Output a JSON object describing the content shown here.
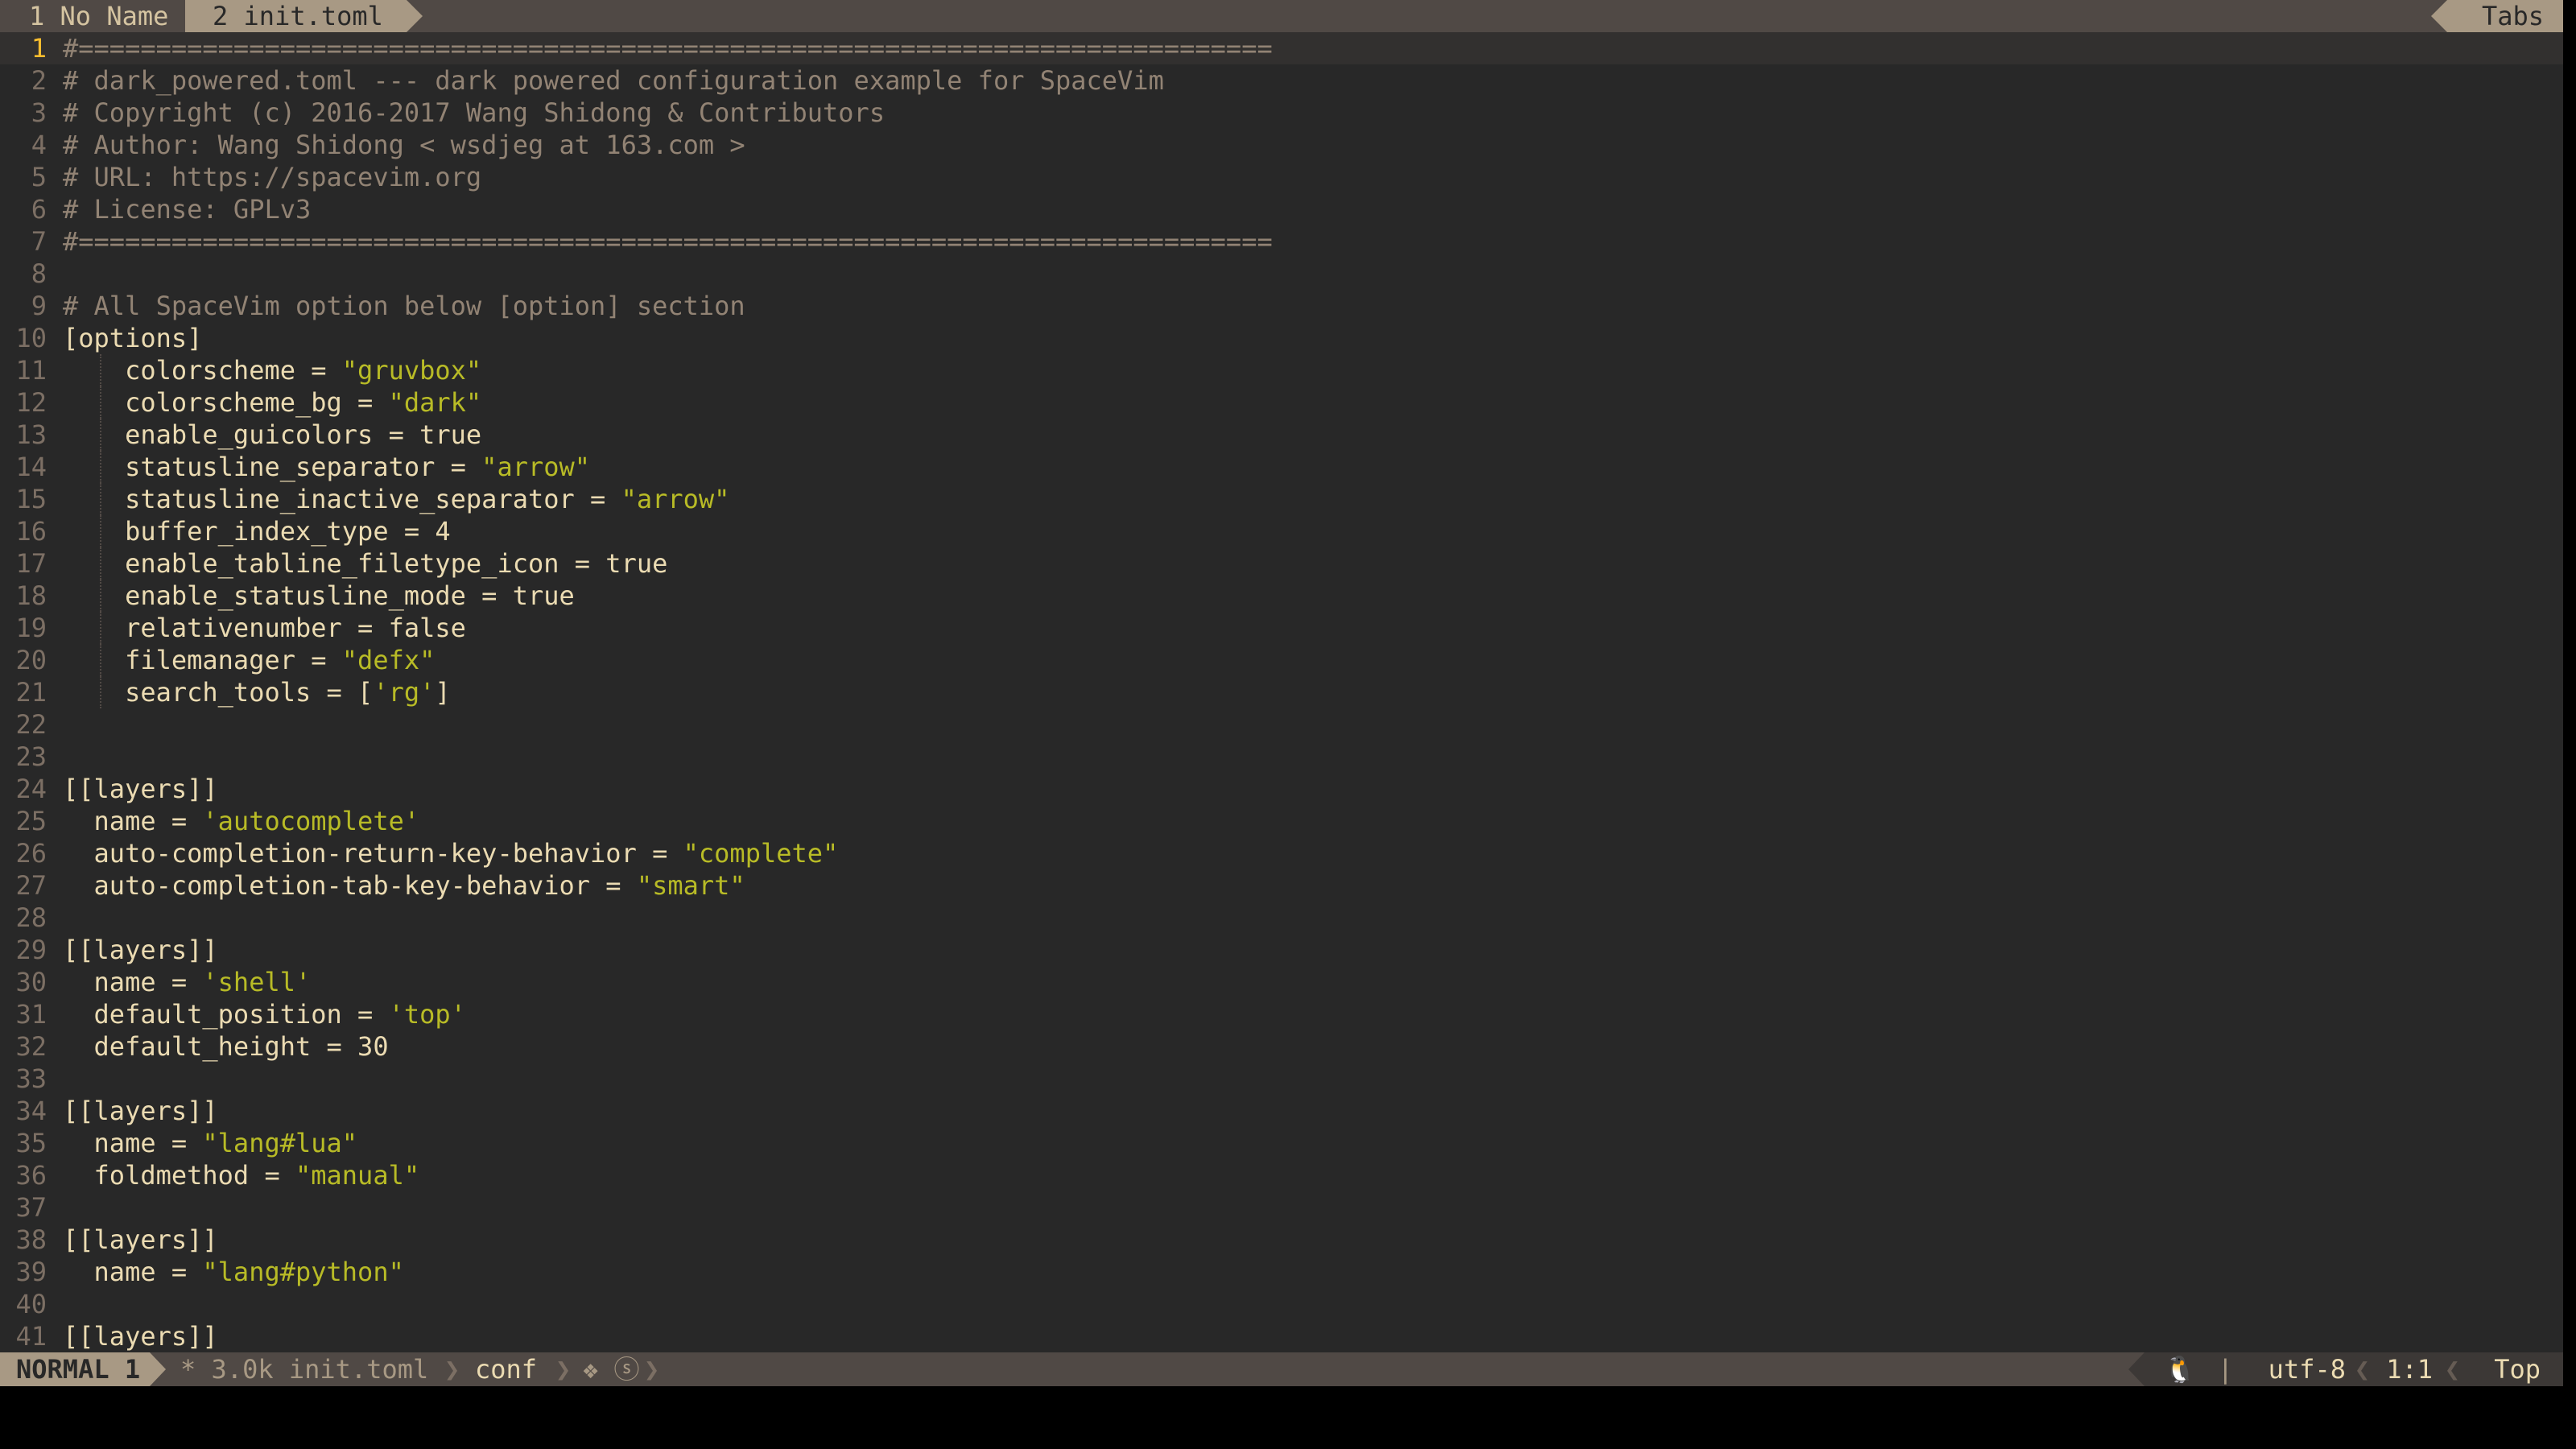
{
  "tabline": {
    "tabs": [
      {
        "index": "1",
        "label": "No Name"
      },
      {
        "index": "2",
        "label": "init.toml"
      }
    ],
    "right_label": "Tabs"
  },
  "editor": {
    "current_line": 1,
    "lines": [
      {
        "n": "1",
        "segments": [
          [
            "cm",
            "#============================================================================="
          ]
        ]
      },
      {
        "n": "2",
        "segments": [
          [
            "cm",
            "# dark_powered.toml --- dark powered configuration example for SpaceVim"
          ]
        ]
      },
      {
        "n": "3",
        "segments": [
          [
            "cm",
            "# Copyright (c) 2016-2017 Wang Shidong & Contributors"
          ]
        ]
      },
      {
        "n": "4",
        "segments": [
          [
            "cm",
            "# Author: Wang Shidong < wsdjeg at 163.com >"
          ]
        ]
      },
      {
        "n": "5",
        "segments": [
          [
            "cm",
            "# URL: https://spacevim.org"
          ]
        ]
      },
      {
        "n": "6",
        "segments": [
          [
            "cm",
            "# License: GPLv3"
          ]
        ]
      },
      {
        "n": "7",
        "segments": [
          [
            "cm",
            "#============================================================================="
          ]
        ]
      },
      {
        "n": "8",
        "segments": []
      },
      {
        "n": "9",
        "segments": [
          [
            "cm",
            "# All SpaceVim option below [option] section"
          ]
        ]
      },
      {
        "n": "10",
        "segments": [
          [
            "kw",
            "[options]"
          ]
        ]
      },
      {
        "n": "11",
        "guide": true,
        "segments": [
          [
            "kw",
            "    colorscheme = "
          ],
          [
            "str",
            "\"gruvbox\""
          ]
        ]
      },
      {
        "n": "12",
        "guide": true,
        "segments": [
          [
            "kw",
            "    colorscheme_bg = "
          ],
          [
            "str",
            "\"dark\""
          ]
        ]
      },
      {
        "n": "13",
        "guide": true,
        "segments": [
          [
            "kw",
            "    enable_guicolors = true"
          ]
        ]
      },
      {
        "n": "14",
        "guide": true,
        "segments": [
          [
            "kw",
            "    statusline_separator = "
          ],
          [
            "str",
            "\"arrow\""
          ]
        ]
      },
      {
        "n": "15",
        "guide": true,
        "segments": [
          [
            "kw",
            "    statusline_inactive_separator = "
          ],
          [
            "str",
            "\"arrow\""
          ]
        ]
      },
      {
        "n": "16",
        "guide": true,
        "segments": [
          [
            "kw",
            "    buffer_index_type = 4"
          ]
        ]
      },
      {
        "n": "17",
        "guide": true,
        "segments": [
          [
            "kw",
            "    enable_tabline_filetype_icon = true"
          ]
        ]
      },
      {
        "n": "18",
        "guide": true,
        "segments": [
          [
            "kw",
            "    enable_statusline_mode = true"
          ]
        ]
      },
      {
        "n": "19",
        "guide": true,
        "segments": [
          [
            "kw",
            "    relativenumber = false"
          ]
        ]
      },
      {
        "n": "20",
        "guide": true,
        "segments": [
          [
            "kw",
            "    filemanager = "
          ],
          [
            "str",
            "\"defx\""
          ]
        ]
      },
      {
        "n": "21",
        "guide": true,
        "segments": [
          [
            "kw",
            "    search_tools = ["
          ],
          [
            "str",
            "'rg'"
          ],
          [
            "kw",
            "]"
          ]
        ]
      },
      {
        "n": "22",
        "segments": []
      },
      {
        "n": "23",
        "segments": []
      },
      {
        "n": "24",
        "segments": [
          [
            "kw",
            "[[layers]]"
          ]
        ]
      },
      {
        "n": "25",
        "segments": [
          [
            "kw",
            "  name = "
          ],
          [
            "str",
            "'autocomplete'"
          ]
        ]
      },
      {
        "n": "26",
        "segments": [
          [
            "kw",
            "  auto-completion-return-key-behavior = "
          ],
          [
            "str",
            "\"complete\""
          ]
        ]
      },
      {
        "n": "27",
        "segments": [
          [
            "kw",
            "  auto-completion-tab-key-behavior = "
          ],
          [
            "str",
            "\"smart\""
          ]
        ]
      },
      {
        "n": "28",
        "segments": []
      },
      {
        "n": "29",
        "segments": [
          [
            "kw",
            "[[layers]]"
          ]
        ]
      },
      {
        "n": "30",
        "segments": [
          [
            "kw",
            "  name = "
          ],
          [
            "str",
            "'shell'"
          ]
        ]
      },
      {
        "n": "31",
        "segments": [
          [
            "kw",
            "  default_position = "
          ],
          [
            "str",
            "'top'"
          ]
        ]
      },
      {
        "n": "32",
        "segments": [
          [
            "kw",
            "  default_height = 30"
          ]
        ]
      },
      {
        "n": "33",
        "segments": []
      },
      {
        "n": "34",
        "segments": [
          [
            "kw",
            "[[layers]]"
          ]
        ]
      },
      {
        "n": "35",
        "segments": [
          [
            "kw",
            "  name = "
          ],
          [
            "str",
            "\"lang#lua\""
          ]
        ]
      },
      {
        "n": "36",
        "segments": [
          [
            "kw",
            "  foldmethod = "
          ],
          [
            "str",
            "\"manual\""
          ]
        ]
      },
      {
        "n": "37",
        "segments": []
      },
      {
        "n": "38",
        "segments": [
          [
            "kw",
            "[[layers]]"
          ]
        ]
      },
      {
        "n": "39",
        "segments": [
          [
            "kw",
            "  name = "
          ],
          [
            "str",
            "\"lang#python\""
          ]
        ]
      },
      {
        "n": "40",
        "segments": []
      },
      {
        "n": "41",
        "segments": [
          [
            "kw",
            "[[layers]]"
          ]
        ]
      }
    ]
  },
  "statusline": {
    "mode": "NORMAL 1",
    "file_info": "* 3.0k init.toml",
    "filetype": "conf",
    "icons": "❖ ⓢ",
    "os_icon": "🐧",
    "encoding": "utf-8",
    "position": "1:1",
    "scroll": "Top"
  },
  "colors": {
    "background": "#282828",
    "comment": "#928374",
    "string": "#b8bb26",
    "foreground": "#ebdbb2",
    "line_number": "#7c6f64",
    "current_line_number": "#fabd2f",
    "bar": "#504945",
    "bar_accent": "#a89984"
  }
}
